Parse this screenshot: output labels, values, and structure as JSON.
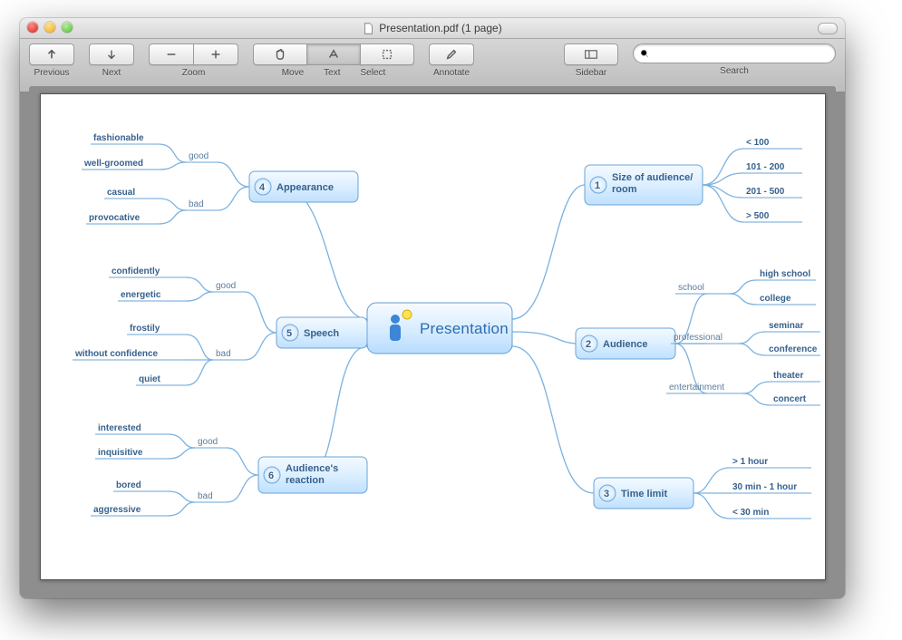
{
  "window": {
    "title": "Presentation.pdf (1 page)"
  },
  "toolbar": {
    "previous": "Previous",
    "next": "Next",
    "zoom": "Zoom",
    "move": "Move",
    "text": "Text",
    "select": "Select",
    "annotate": "Annotate",
    "sidebar": "Sidebar",
    "search": "Search",
    "search_placeholder": ""
  },
  "mindmap": {
    "center": "Presentation",
    "branches": [
      {
        "num": "1",
        "label": "Size of audience/room",
        "children": [
          {
            "label": "< 100"
          },
          {
            "label": "101 - 200"
          },
          {
            "label": "201 - 500"
          },
          {
            "label": "> 500"
          }
        ]
      },
      {
        "num": "2",
        "label": "Audience",
        "children": [
          {
            "label": "school",
            "children": [
              {
                "label": "high school"
              },
              {
                "label": "college"
              }
            ]
          },
          {
            "label": "professional",
            "children": [
              {
                "label": "seminar"
              },
              {
                "label": "conference"
              }
            ]
          },
          {
            "label": "entertainment",
            "children": [
              {
                "label": "theater"
              },
              {
                "label": "concert"
              }
            ]
          }
        ]
      },
      {
        "num": "3",
        "label": "Time limit",
        "children": [
          {
            "label": "> 1 hour"
          },
          {
            "label": "30 min - 1 hour"
          },
          {
            "label": "< 30 min"
          }
        ]
      },
      {
        "num": "4",
        "label": "Appearance",
        "children": [
          {
            "label": "good",
            "children": [
              {
                "label": "fashionable"
              },
              {
                "label": "well-groomed"
              }
            ]
          },
          {
            "label": "bad",
            "children": [
              {
                "label": "casual"
              },
              {
                "label": "provocative"
              }
            ]
          }
        ]
      },
      {
        "num": "5",
        "label": "Speech",
        "children": [
          {
            "label": "good",
            "children": [
              {
                "label": "confidently"
              },
              {
                "label": "energetic"
              }
            ]
          },
          {
            "label": "bad",
            "children": [
              {
                "label": "frostily"
              },
              {
                "label": "without confidence"
              },
              {
                "label": "quiet"
              }
            ]
          }
        ]
      },
      {
        "num": "6",
        "label": "Audience's reaction",
        "children": [
          {
            "label": "good",
            "children": [
              {
                "label": "interested"
              },
              {
                "label": "inquisitive"
              }
            ]
          },
          {
            "label": "bad",
            "children": [
              {
                "label": "bored"
              },
              {
                "label": "aggressive"
              }
            ]
          }
        ]
      }
    ]
  }
}
